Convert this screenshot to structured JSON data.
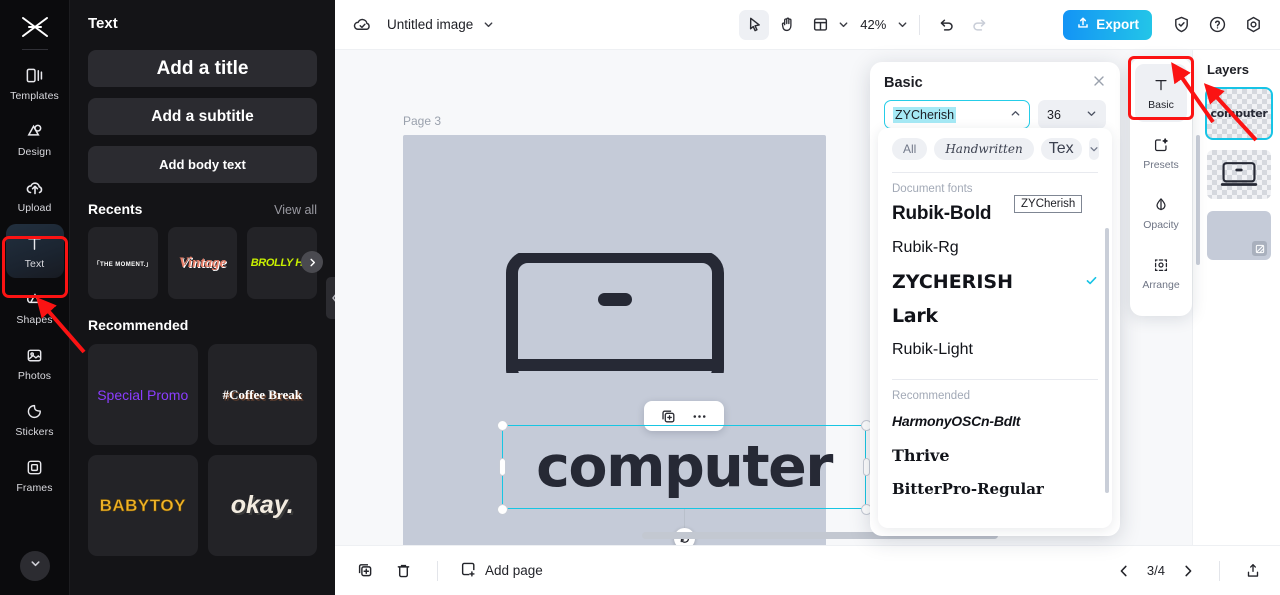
{
  "rail": {
    "logo_icon": "capcut-logo-icon",
    "items": [
      {
        "label": "Templates",
        "icon": "templates-icon",
        "active": false
      },
      {
        "label": "Design",
        "icon": "design-icon",
        "active": false
      },
      {
        "label": "Upload",
        "icon": "upload-cloud-icon",
        "active": false
      },
      {
        "label": "Text",
        "icon": "text-t-icon",
        "active": true
      },
      {
        "label": "Shapes",
        "icon": "shapes-icon",
        "active": false
      },
      {
        "label": "Photos",
        "icon": "photos-icon",
        "active": false
      },
      {
        "label": "Stickers",
        "icon": "stickers-icon",
        "active": false
      },
      {
        "label": "Frames",
        "icon": "frames-icon",
        "active": false
      }
    ],
    "collapse_icon": "chevron-down-icon"
  },
  "text_panel": {
    "title": "Text",
    "buttons": [
      {
        "label": "Add a title"
      },
      {
        "label": "Add a subtitle"
      },
      {
        "label": "Add body text"
      }
    ],
    "recents": {
      "heading": "Recents",
      "view_all": "View all",
      "items": [
        {
          "label": "「THE MOMENT.」"
        },
        {
          "label": "Vintage"
        },
        {
          "label": "BROLLY HO."
        }
      ],
      "next_icon": "chevron-right-icon"
    },
    "recommended": {
      "heading": "Recommended",
      "items": [
        {
          "label": "Special Promo"
        },
        {
          "label": "#Coffee Break"
        },
        {
          "label": "BABYTOY"
        },
        {
          "label": "okay."
        }
      ]
    },
    "collapse_icon": "chevron-left-icon"
  },
  "topbar": {
    "cloud_icon": "cloud-saved-icon",
    "doc_title": "Untitled image",
    "title_caret_icon": "chevron-down-icon",
    "tools": [
      {
        "name": "select-tool",
        "icon": "cursor-arrow-icon",
        "selected": true
      },
      {
        "name": "hand-tool",
        "icon": "hand-icon",
        "selected": false
      },
      {
        "name": "layout-tool",
        "icon": "layout-icon",
        "selected": false
      }
    ],
    "layout_caret_icon": "chevron-down-icon",
    "zoom": "42%",
    "zoom_caret_icon": "chevron-down-icon",
    "undo_icon": "undo-icon",
    "redo_icon": "redo-icon",
    "export_label": "Export",
    "export_icon": "export-upload-icon",
    "shield_icon": "shield-icon",
    "help_icon": "question-circle-icon",
    "settings_icon": "gear-icon",
    "accent_color": "#1394f5"
  },
  "canvas": {
    "page_label": "Page 3",
    "duplicate_icon": "duplicate-page-icon",
    "more_icon": "more-dots-icon",
    "artboard_color": "#c5cbd8",
    "selected_text": "computer",
    "float_bar": {
      "duplicate_icon": "duplicate-icon",
      "more_icon": "more-dots-icon"
    },
    "rotate_icon": "rotate-icon"
  },
  "basic_panel": {
    "title": "Basic",
    "close_icon": "close-icon",
    "font_value": "ZYCherish",
    "font_caret_icon": "chevron-up-icon",
    "size_value": "36",
    "size_caret_icon": "chevron-down-icon",
    "tooltip": "ZYCherish",
    "chips": [
      {
        "label": "All",
        "active": true
      },
      {
        "label": "Handwritten",
        "active": false
      },
      {
        "label": "Tex",
        "active": false
      }
    ],
    "chip_caret_icon": "chevron-down-icon",
    "groups": [
      {
        "label": "Document fonts",
        "fonts": [
          {
            "name": "Rubik-Bold",
            "style": "f-rubik-bold",
            "selected": false
          },
          {
            "name": "Rubik-Rg",
            "style": "f-rubik-rg",
            "selected": false
          },
          {
            "name": "ZYCHERISH",
            "style": "f-zycherish",
            "selected": true
          },
          {
            "name": "Lark",
            "style": "f-lark",
            "selected": false
          },
          {
            "name": "Rubik-Light",
            "style": "f-rubik-light",
            "selected": false
          }
        ]
      },
      {
        "label": "Recommended",
        "fonts": [
          {
            "name": "HarmonyOSCn-BdIt",
            "style": "f-harmony",
            "selected": false
          },
          {
            "name": "Thrive",
            "style": "f-thrive",
            "selected": false
          },
          {
            "name": "BitterPro-Regular",
            "style": "f-bitter",
            "selected": false
          }
        ]
      }
    ],
    "check_icon": "check-icon",
    "check_color": "#17c4e6"
  },
  "tool_rail": {
    "items": [
      {
        "label": "Basic",
        "icon": "text-t-icon",
        "selected": true
      },
      {
        "label": "Presets",
        "icon": "presets-icon",
        "selected": false
      },
      {
        "label": "Opacity",
        "icon": "opacity-drop-icon",
        "selected": false
      },
      {
        "label": "Arrange",
        "icon": "arrange-icon",
        "selected": false
      }
    ]
  },
  "layers": {
    "title": "Layers",
    "items": [
      {
        "name": "computer",
        "type": "text",
        "selected": true
      },
      {
        "name": "laptop-illustration",
        "type": "image",
        "selected": false
      },
      {
        "name": "background",
        "type": "background",
        "selected": false
      }
    ],
    "badge_icon": "image-badge-icon"
  },
  "bottombar": {
    "duplicate_icon": "duplicate-page-icon",
    "delete_icon": "trash-icon",
    "add_page_label": "Add page",
    "add_page_icon": "add-page-icon",
    "prev_icon": "chevron-left-icon",
    "page_indicator": "3/4",
    "next_icon": "chevron-right-icon",
    "export_icon": "export-upload-icon"
  },
  "annotations": {
    "highlight_color": "#fb1313",
    "arrow_text_tool": "arrow-to-text-tool",
    "arrow_basic_tab": "arrow-to-basic-tab",
    "arrow_layer": "arrow-to-selected-layer"
  }
}
